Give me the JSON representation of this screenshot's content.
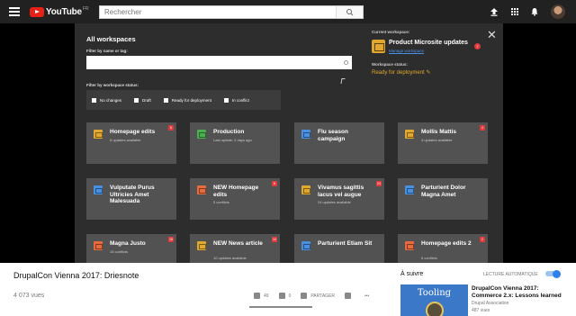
{
  "topbar": {
    "logo_text": "YouTube",
    "logo_country": "FR",
    "search_placeholder": "Rechercher"
  },
  "modal": {
    "title": "All workspaces",
    "filter_label": "Filter by name or tag:",
    "status_filter_label": "Filter by workspace status:",
    "status_options": [
      "No changes",
      "Draft",
      "Ready for deployment",
      "In conflict"
    ],
    "current_label": "Current workspace:",
    "current_name": "Product Microsite updates",
    "current_badge": "7",
    "manage_link": "Manage workspace",
    "status_label": "Workspace status:",
    "status_value": "Ready for deployment ✎",
    "close": "✕"
  },
  "cards": [
    {
      "title": "Homepage edits",
      "sub": "5 updates available",
      "badge": "5",
      "color": "#e0a82e"
    },
    {
      "title": "Production",
      "sub": "Last update: 2 days ago",
      "badge": "",
      "color": "#4caf50"
    },
    {
      "title": "Flu season campaign",
      "sub": "",
      "badge": "",
      "color": "#4a90e2"
    },
    {
      "title": "Mollis Mattis",
      "sub": "4 updates available",
      "badge": "4",
      "color": "#e0a82e"
    },
    {
      "title": "Vulputate Purus Ultricies Amet Malesuada",
      "sub": "",
      "badge": "",
      "color": "#4a90e2"
    },
    {
      "title": "NEW Homepage edits",
      "sub": "5 conflicts",
      "badge": "5",
      "color": "#e86b3e"
    },
    {
      "title": "Vivamus sagittis lacus vel augue",
      "sub": "24 updates available",
      "badge": "24",
      "color": "#e0a82e"
    },
    {
      "title": "Parturient Dolor Magna Amet",
      "sub": "",
      "badge": "",
      "color": "#4a90e2"
    },
    {
      "title": "Magna Justo",
      "sub": "15 conflicts",
      "badge": "15",
      "color": "#e86b3e"
    },
    {
      "title": "NEW News article",
      "sub": "10 updates available",
      "badge": "10",
      "color": "#e0a82e"
    },
    {
      "title": "Parturient Etiam Sit",
      "sub": "",
      "badge": "",
      "color": "#4a90e2"
    },
    {
      "title": "Homepage edits 2",
      "sub": "5 conflicts",
      "badge": "2",
      "color": "#e86b3e"
    }
  ],
  "video": {
    "title": "DrupalCon Vienna 2017: Driesnote",
    "views": "4 073 vues",
    "likes": "49",
    "dislikes": "0",
    "share": "PARTAGER",
    "like_ratio": 1.0
  },
  "upnext": {
    "label": "À suivre",
    "autoplay": "LECTURE AUTOMATIQUE",
    "thumb_text": "Tooling",
    "title": "DrupalCon Vienna 2017: Commerce 2.x: Lessons learned",
    "channel": "Drupal Association",
    "views": "487 vues"
  }
}
